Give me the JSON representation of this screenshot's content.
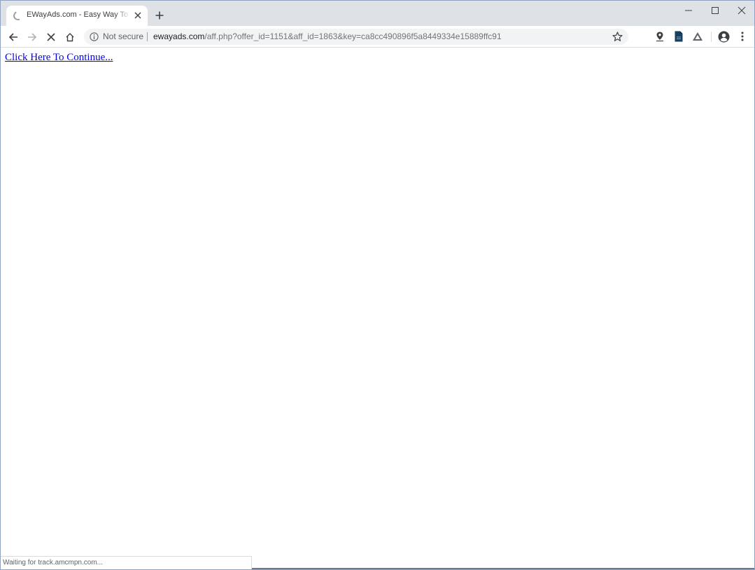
{
  "tab": {
    "title": "EWayAds.com - Easy Way To Advertise",
    "close_icon": "close-icon",
    "loading_icon": "loading-spinner-icon"
  },
  "new_tab_icon": "plus-icon",
  "window_controls": [
    "minimize-icon",
    "maximize-icon",
    "close-icon"
  ],
  "toolbar": {
    "back_icon": "back-arrow-icon",
    "forward_icon": "forward-arrow-icon",
    "stop_icon": "stop-icon",
    "home_icon": "home-icon"
  },
  "omnibox": {
    "security_label": "Not secure",
    "url_host": "ewayads.com",
    "url_path": "/aff.php?offer_id=1151&aff_id=1863&key=ca8cc490896f5a8449334e15889ffc91",
    "bookmark_icon": "star-icon"
  },
  "extensions": [
    "location-pin-icon",
    "document-icon",
    "drive-icon"
  ],
  "profile_icon": "account-circle-icon",
  "menu_icon": "more-vertical-icon",
  "page": {
    "link_text": "Click Here To Continue..."
  },
  "status": {
    "text": "Waiting for track.amcmpn.com..."
  },
  "colors": {
    "tabstrip": "#dee1e6",
    "link": "#0000ee",
    "omnibox": "#f1f3f4"
  }
}
